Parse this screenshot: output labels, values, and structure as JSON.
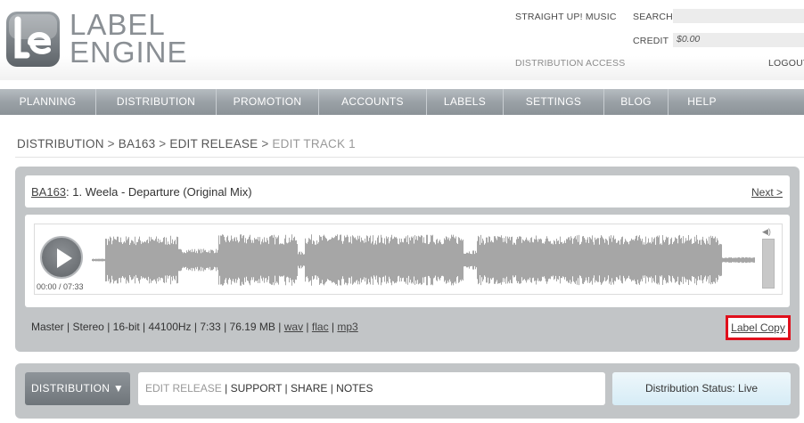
{
  "logo": {
    "line1": "LABEL",
    "line2": "ENGINE",
    "mark": "le"
  },
  "header": {
    "account_name": "STRAIGHT UP! MUSIC",
    "search_label": "SEARCH",
    "search_value": "",
    "credit_label": "CREDIT",
    "credit_value": "$0.00",
    "distribution_access": "DISTRIBUTION ACCESS",
    "logout": "LOGOUT"
  },
  "nav": {
    "items": [
      "PLANNING",
      "DISTRIBUTION",
      "PROMOTION",
      "ACCOUNTS",
      "LABELS",
      "SETTINGS",
      "BLOG",
      "HELP"
    ]
  },
  "breadcrumb": {
    "items": [
      "DISTRIBUTION",
      "BA163",
      "EDIT RELEASE"
    ],
    "separator": ">",
    "current": "EDIT TRACK 1"
  },
  "track": {
    "release_link": "BA163",
    "title_rest": ": 1. Weela - Departure (Original Mix)",
    "next": "Next >"
  },
  "player": {
    "time": "00:00 / 07:33",
    "progress": 0,
    "waveform_color": "#a6a6a6",
    "play_icon": "play-icon",
    "volume_icon": "speaker-icon"
  },
  "meta": {
    "source": "Master",
    "channels": "Stereo",
    "bit_depth": "16-bit",
    "sample_rate": "44100Hz",
    "duration": "7:33",
    "size": "76.19 MB",
    "separator": "|",
    "formats": [
      "wav",
      "flac",
      "mp3"
    ],
    "label_copy": "Label Copy",
    "highlight_color": "#e0101c"
  },
  "bottom": {
    "dropdown_label": "DISTRIBUTION ▼",
    "submenu_current": "EDIT RELEASE",
    "submenu": [
      "SUPPORT",
      "SHARE",
      "NOTES"
    ],
    "status": "Distribution Status: Live"
  }
}
